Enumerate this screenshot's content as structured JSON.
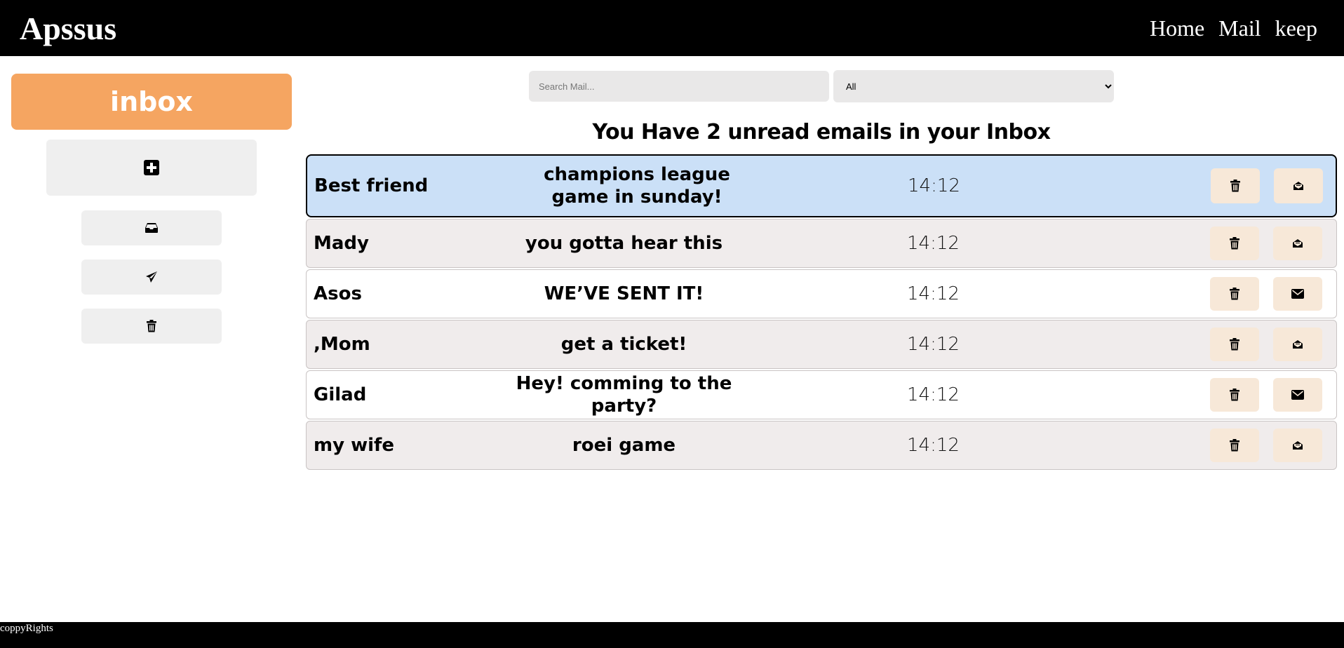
{
  "app": {
    "logo": "Apssus"
  },
  "nav": {
    "items": [
      "Home",
      "Mail",
      "keep"
    ]
  },
  "sidebar": {
    "title": "inbox",
    "compose_icon": "plus-square-icon",
    "buttons": [
      {
        "name": "inbox",
        "icon": "inbox-tray-icon"
      },
      {
        "name": "sent",
        "icon": "paper-plane-icon"
      },
      {
        "name": "trash",
        "icon": "trash-icon"
      }
    ]
  },
  "search": {
    "placeholder": "Search Mail...",
    "value": ""
  },
  "filter": {
    "selected": "All"
  },
  "heading": "You Have 2 unread emails in your Inbox",
  "emails": [
    {
      "from": "Best friend",
      "subject": "champions league game in sunday!",
      "time": "14:12",
      "status_icon": "envelope-open-icon",
      "selected": true
    },
    {
      "from": "Mady",
      "subject": "you gotta hear this",
      "time": "14:12",
      "status_icon": "envelope-open-icon"
    },
    {
      "from": "Asos",
      "subject": "WE’VE SENT IT!",
      "time": "14:12",
      "status_icon": "envelope-icon"
    },
    {
      "from": ",Mom",
      "subject": "get a ticket!",
      "time": "14:12",
      "status_icon": "envelope-open-icon"
    },
    {
      "from": "Gilad",
      "subject": "Hey! comming to the party?",
      "time": "14:12",
      "status_icon": "envelope-icon"
    },
    {
      "from": "my wife",
      "subject": "roei game",
      "time": "14:12",
      "status_icon": "envelope-open-icon"
    }
  ],
  "colors": {
    "header_bg": "#000000",
    "inbox_title_bg": "#f5a561",
    "selected_row_bg": "#cbe0f7",
    "alt_row_bg": "#f0ecec",
    "action_button_bg": "#f7e8d8"
  },
  "footer": {
    "text": "coppyRights"
  }
}
